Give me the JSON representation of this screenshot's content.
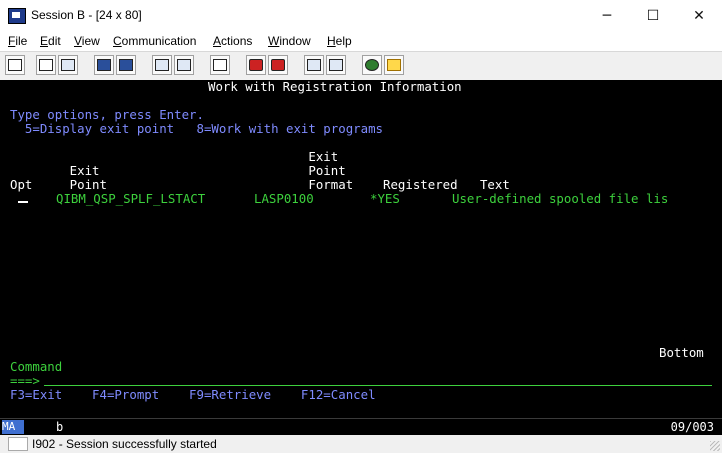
{
  "window": {
    "title": "Session B - [24 x 80]",
    "minimize_glyph": "─",
    "maximize_glyph": "☐",
    "close_glyph": "✕"
  },
  "menu": {
    "items": [
      {
        "ul": "F",
        "rest": "ile"
      },
      {
        "ul": "E",
        "rest": "dit"
      },
      {
        "ul": "V",
        "rest": "iew"
      },
      {
        "ul": "C",
        "rest": "ommunication"
      },
      {
        "ul": "A",
        "rest": "ctions"
      },
      {
        "ul": "W",
        "rest": "indow"
      },
      {
        "ul": "H",
        "rest": "elp"
      }
    ]
  },
  "toolbar": {
    "icons": [
      "print-icon",
      "copy-icon",
      "paste-icon",
      "send-icon",
      "receive-icon",
      "display-icon",
      "macro-icon",
      "keyboard-icon",
      "record-icon",
      "stop-icon",
      "play-icon",
      "quick-record-icon",
      "globe-icon",
      "edit-icon"
    ]
  },
  "screen": {
    "title": "Work with Registration Information",
    "instructions": "Type options, press Enter.",
    "options": "  5=Display exit point   8=Work with exit programs",
    "header1": "                                        Exit",
    "header2": "        Exit                            Point",
    "header3": "Opt     Point                           Format    Registered   Text",
    "row": {
      "opt": "",
      "exit_point": "QIBM_QSP_SPLF_LSTACT",
      "format": "LASP0100",
      "registered": "*YES",
      "text": "User-defined spooled file lis"
    },
    "bottom_label": "Bottom",
    "command_label": "Command",
    "command_prompt": "===>",
    "function_keys": "F3=Exit    F4=Prompt    F9=Retrieve    F12=Cancel"
  },
  "oia": {
    "mode": "MA",
    "indicator": "b",
    "cursor_pos": "09/003"
  },
  "status": {
    "message": "I902 - Session successfully started"
  }
}
